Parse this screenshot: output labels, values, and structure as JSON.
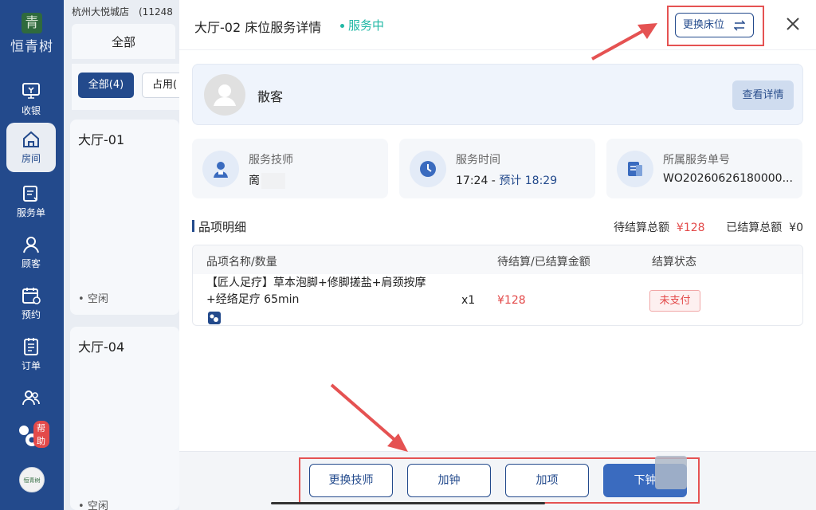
{
  "nav": {
    "logo_text": "恒青树",
    "logo_mark": "青",
    "items": [
      {
        "label": "收银",
        "icon": "cashier-icon"
      },
      {
        "label": "房间",
        "icon": "room-icon"
      },
      {
        "label": "服务单",
        "icon": "service-order-icon"
      },
      {
        "label": "顾客",
        "icon": "customer-icon"
      },
      {
        "label": "预约",
        "icon": "calendar-icon"
      },
      {
        "label": "订单",
        "icon": "order-icon"
      },
      {
        "label": "",
        "icon": "staff-icon"
      }
    ],
    "help_badge": "帮助",
    "store_avatar_text": "恒青树"
  },
  "list": {
    "store_name": "杭州大悦城店　(11248",
    "tab_all": "全部",
    "chip_all": "全部(4)",
    "chip_used": "占用(",
    "rooms": [
      {
        "title": "大厅-01",
        "status": "空闲"
      },
      {
        "title": "大厅-04",
        "status": "空闲"
      }
    ]
  },
  "drawer": {
    "title": "大厅-02 床位服务详情",
    "status": "服务中",
    "swap_bed_label": "更换床位",
    "customer": {
      "name": "散客",
      "view_label": "查看详情"
    },
    "info": [
      {
        "label": "服务技师",
        "value": "啇"
      },
      {
        "label": "服务时间",
        "value_start": "17:24 -",
        "value_est": "预计 18:29"
      },
      {
        "label": "所属服务单号",
        "value": "WO20260626180000..."
      }
    ],
    "section_title": "品项明细",
    "totals": {
      "pending_label": "待结算总额",
      "pending_value": "¥128",
      "settled_label": "已结算总额",
      "settled_value": "¥0"
    },
    "table": {
      "headers": [
        "品项名称/数量",
        "待结算/已结算金额",
        "结算状态"
      ],
      "rows": [
        {
          "name": "【匠人足疗】草本泡脚+修脚搓盐+肩颈按摩+经络足疗 65min",
          "qty": "x1",
          "amount": "¥128",
          "status": "未支付"
        }
      ]
    },
    "actions": {
      "change_tech": "更换技师",
      "add_time": "加钟",
      "add_item": "加项",
      "end": "下钟"
    }
  },
  "colors": {
    "nav_bg": "#234a8c",
    "accent": "#234a8c",
    "status_green": "#21b8a5",
    "price_red": "#e34a4a",
    "annotation_red": "#e55252"
  }
}
